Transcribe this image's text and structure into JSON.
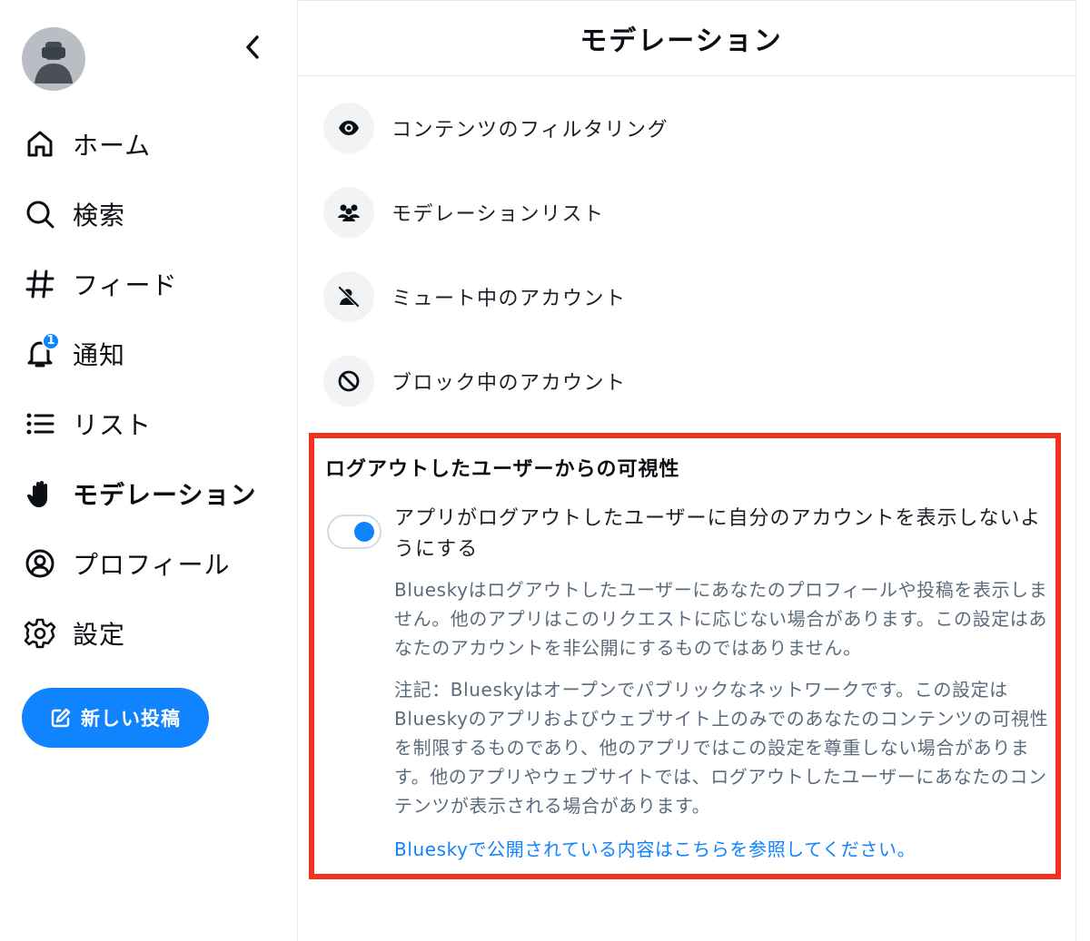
{
  "sidebar": {
    "nav": [
      {
        "label": "ホーム",
        "icon": "home-icon"
      },
      {
        "label": "検索",
        "icon": "search-icon"
      },
      {
        "label": "フィード",
        "icon": "hashtag-icon"
      },
      {
        "label": "通知",
        "icon": "bell-icon",
        "badge": "1"
      },
      {
        "label": "リスト",
        "icon": "list-icon"
      },
      {
        "label": "モデレーション",
        "icon": "hand-icon",
        "active": true
      },
      {
        "label": "プロフィール",
        "icon": "profile-icon"
      },
      {
        "label": "設定",
        "icon": "gear-icon"
      }
    ],
    "compose_label": "新しい投稿"
  },
  "header": {
    "title": "モデレーション"
  },
  "menu": [
    {
      "label": "コンテンツのフィルタリング",
      "icon": "eye-icon"
    },
    {
      "label": "モデレーションリスト",
      "icon": "users-icon"
    },
    {
      "label": "ミュート中のアカウント",
      "icon": "person-muted-icon"
    },
    {
      "label": "ブロック中のアカウント",
      "icon": "block-icon"
    }
  ],
  "visibility": {
    "title": "ログアウトしたユーザーからの可視性",
    "toggle_label": "アプリがログアウトしたユーザーに自分のアカウントを表示しないようにする",
    "toggle_on": true,
    "description1": "Blueskyはログアウトしたユーザーにあなたのプロフィールや投稿を表示しません。他のアプリはこのリクエストに応じない場合があります。この設定はあなたのアカウントを非公開にするものではありません。",
    "description2": "注記：Blueskyはオープンでパブリックなネットワークです。この設定はBlueskyのアプリおよびウェブサイト上のみでのあなたのコンテンツの可視性を制限するものであり、他のアプリではこの設定を尊重しない場合があります。他のアプリやウェブサイトでは、ログアウトしたユーザーにあなたのコンテンツが表示される場合があります。",
    "link": "Blueskyで公開されている内容はこちらを参照してください。"
  },
  "colors": {
    "accent": "#1083fe",
    "highlight_border": "#f2311f",
    "muted_text": "#5b6b7c"
  }
}
